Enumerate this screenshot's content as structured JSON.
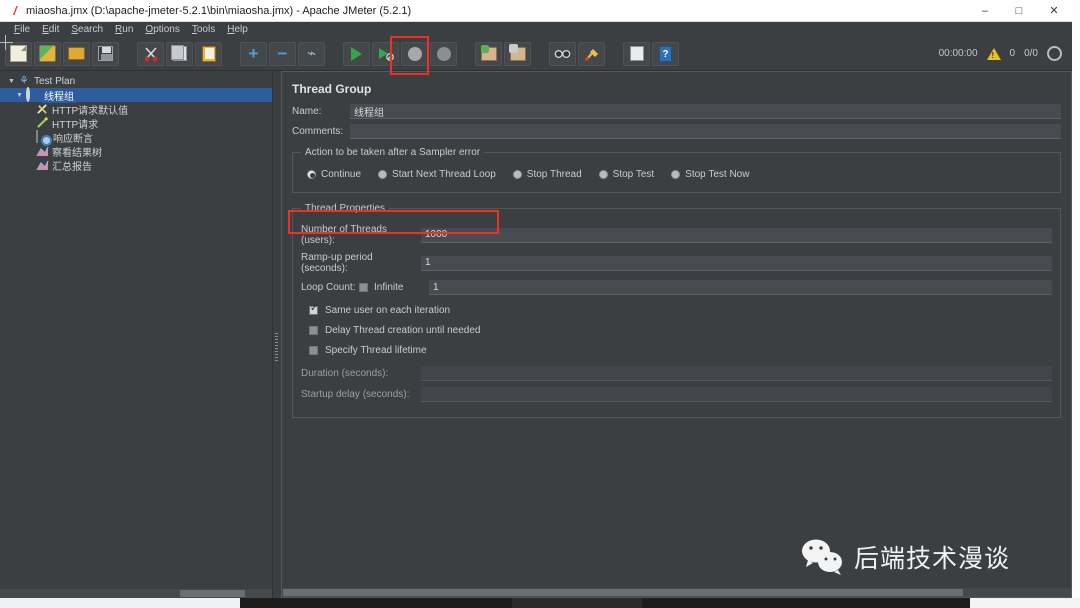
{
  "window": {
    "title": "miaosha.jmx (D:\\apache-jmeter-5.2.1\\bin\\miaosha.jmx) - Apache JMeter (5.2.1)",
    "app_icon": "jmeter-feather-icon",
    "minimize": "–",
    "maximize": "□",
    "close": "✕"
  },
  "menubar": {
    "items": [
      {
        "label": "File",
        "mnemonic": "F"
      },
      {
        "label": "Edit",
        "mnemonic": "E"
      },
      {
        "label": "Search",
        "mnemonic": "S"
      },
      {
        "label": "Run",
        "mnemonic": "R"
      },
      {
        "label": "Options",
        "mnemonic": "O"
      },
      {
        "label": "Tools",
        "mnemonic": "T"
      },
      {
        "label": "Help",
        "mnemonic": "H"
      }
    ]
  },
  "toolbar": {
    "groups": [
      [
        "new-icon",
        "templates-icon",
        "open-icon",
        "save-icon"
      ],
      [
        "cut-icon",
        "copy-icon",
        "paste-icon"
      ],
      [
        "expand-icon",
        "collapse-icon",
        "toggle-icon"
      ],
      [
        "start-icon",
        "start-no-pauses-icon",
        "stop-icon",
        "shutdown-icon"
      ],
      [
        "clear-icon",
        "clear-all-icon"
      ],
      [
        "search-icon",
        "reset-search-icon"
      ],
      [
        "function-helper-icon",
        "help-icon"
      ]
    ],
    "status": {
      "elapsed": "00:00:00",
      "warning_icon": "warning-triangle-icon",
      "warning_count": "0",
      "threads": "0/0",
      "remote_icon": "globe-icon"
    }
  },
  "annotations": {
    "start_button_highlight_color": "#ee3124",
    "threads_field_highlight_color": "#ee3124"
  },
  "tree": {
    "nodes": [
      {
        "label": "Test Plan",
        "icon": "test-plan-icon",
        "indent": 0,
        "expanded": true,
        "selected": false
      },
      {
        "label": "线程组",
        "icon": "thread-group-icon",
        "indent": 1,
        "expanded": true,
        "selected": true
      },
      {
        "label": "HTTP请求默认值",
        "icon": "http-defaults-icon",
        "indent": 2,
        "expanded": false,
        "selected": false
      },
      {
        "label": "HTTP请求",
        "icon": "http-sampler-icon",
        "indent": 2,
        "expanded": false,
        "selected": false
      },
      {
        "label": "响应断言",
        "icon": "response-assertion-icon",
        "indent": 2,
        "expanded": false,
        "selected": false
      },
      {
        "label": "察看结果树",
        "icon": "view-results-tree-icon",
        "indent": 2,
        "expanded": false,
        "selected": false
      },
      {
        "label": "汇总报告",
        "icon": "summary-report-icon",
        "indent": 2,
        "expanded": false,
        "selected": false
      }
    ]
  },
  "content": {
    "title": "Thread Group",
    "name_label": "Name:",
    "name_value": "线程组",
    "comments_label": "Comments:",
    "comments_value": "",
    "error_action": {
      "legend": "Action to be taken after a Sampler error",
      "options": [
        {
          "label": "Continue",
          "checked": true
        },
        {
          "label": "Start Next Thread Loop",
          "checked": false
        },
        {
          "label": "Stop Thread",
          "checked": false
        },
        {
          "label": "Stop Test",
          "checked": false
        },
        {
          "label": "Stop Test Now",
          "checked": false
        }
      ]
    },
    "thread_properties": {
      "legend": "Thread Properties",
      "num_threads_label": "Number of Threads (users):",
      "num_threads_value": "1000",
      "ramp_up_label": "Ramp-up period (seconds):",
      "ramp_up_value": "1",
      "loop_count_label": "Loop Count:",
      "loop_infinite_label": "Infinite",
      "loop_infinite_checked": false,
      "loop_count_value": "1",
      "same_user_label": "Same user on each iteration",
      "same_user_checked": true,
      "delay_thread_label": "Delay Thread creation until needed",
      "delay_thread_checked": false,
      "specify_lifetime_label": "Specify Thread lifetime",
      "specify_lifetime_checked": false,
      "duration_label": "Duration (seconds):",
      "duration_value": "",
      "startup_delay_label": "Startup delay (seconds):",
      "startup_delay_value": ""
    }
  },
  "watermark": {
    "icon": "wechat-icon",
    "text": "后端技术漫谈"
  }
}
